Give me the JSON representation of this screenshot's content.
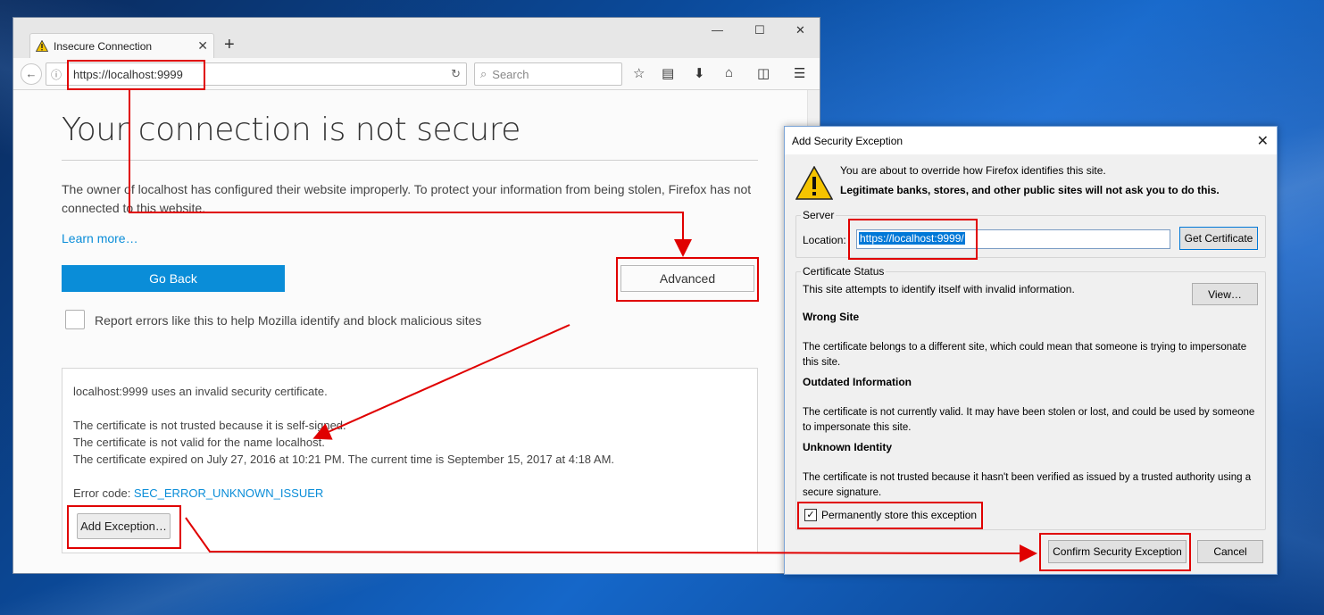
{
  "browser": {
    "tab_title": "Insecure Connection",
    "url": "https://localhost:9999",
    "search_placeholder": "Search",
    "icons": [
      "warning-icon",
      "close-icon",
      "new-tab-icon",
      "minimize-icon",
      "maximize-icon",
      "back-icon",
      "info-icon",
      "reload-icon",
      "search-icon",
      "bookmark-star-icon",
      "reading-list-icon",
      "download-icon",
      "home-icon",
      "pocket-icon",
      "menu-icon"
    ]
  },
  "error_page": {
    "title": "Your connection is not secure",
    "description": "The owner of localhost has configured their website improperly. To protect your information from being stolen, Firefox has not connected to this website.",
    "learn_more": "Learn more…",
    "go_back": "Go Back",
    "advanced": "Advanced",
    "report_label": "Report errors like this to help Mozilla identify and block malicious sites",
    "advanced_panel": {
      "line1": "localhost:9999 uses an invalid security certificate.",
      "line2": "The certificate is not trusted because it is self-signed.",
      "line3": "The certificate is not valid for the name localhost.",
      "line4": "The certificate expired on July 27, 2016 at 10:21 PM. The current time is September 15, 2017 at 4:18 AM.",
      "error_code_label": "Error code: ",
      "error_code": "SEC_ERROR_UNKNOWN_ISSUER",
      "add_exception": "Add Exception…"
    }
  },
  "dialog": {
    "title": "Add Security Exception",
    "warning_line1": "You are about to override how Firefox identifies this site.",
    "warning_line2": "Legitimate banks, stores, and other public sites will not ask you to do this.",
    "server_label": "Server",
    "location_label": "Location:",
    "location_value": "https://localhost:9999/",
    "get_certificate": "Get Certificate",
    "cert_status_label": "Certificate Status",
    "cert_status_text": "This site attempts to identify itself with invalid information.",
    "view": "View…",
    "wrong_site_heading": "Wrong Site",
    "wrong_site_text": "The certificate belongs to a different site, which could mean that someone is trying to impersonate this site.",
    "outdated_heading": "Outdated Information",
    "outdated_text": "The certificate is not currently valid. It may have been stolen or lost, and could be used by someone to impersonate this site.",
    "unknown_heading": "Unknown Identity",
    "unknown_text": "The certificate is not trusted because it hasn't been verified as issued by a trusted authority using a secure signature.",
    "permanent_label": "Permanently store this exception",
    "permanent_checked": true,
    "confirm": "Confirm Security Exception",
    "cancel": "Cancel"
  },
  "colors": {
    "annotation": "#e00000",
    "firefox_blue": "#0a8dd8"
  }
}
